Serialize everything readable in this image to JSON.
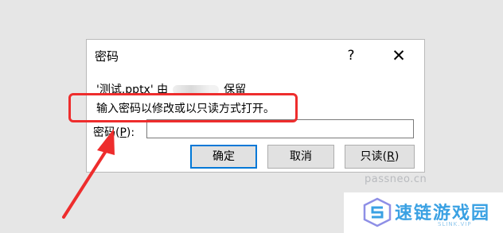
{
  "dialog": {
    "title": "密码",
    "help_glyph": "?",
    "close_glyph": "✕",
    "info_prefix": "'测试.pptx' 由",
    "info_suffix": "保留",
    "instruction": "输入密码以修改或以只读方式打开。",
    "password_label_pre": "密码(",
    "password_label_key": "P",
    "password_label_post": "):",
    "password_value": "",
    "ok_label": "确定",
    "cancel_label": "取消",
    "readonly_label_pre": "只读(",
    "readonly_label_key": "R",
    "readonly_label_post": ")"
  },
  "annotation": {
    "color": "#ee2d2d"
  },
  "watermark": {
    "domain": "passneo.cn",
    "brand_cn": "速链游戏园",
    "brand_en": "SLINK.VIP"
  }
}
